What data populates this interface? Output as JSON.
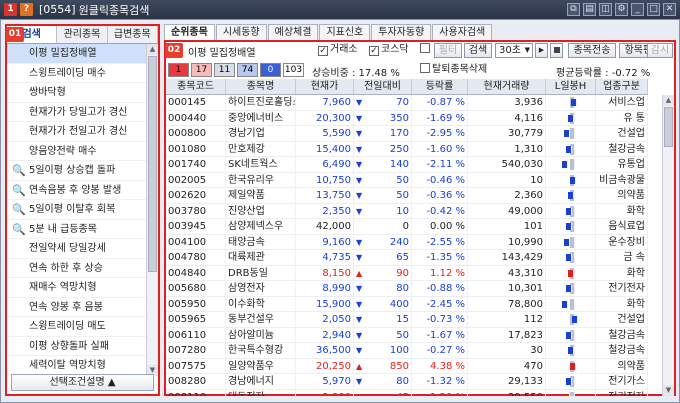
{
  "window": {
    "code": "[0554]",
    "title": "원클릭종목검색",
    "icon_one": "1",
    "icon_q": "?"
  },
  "badges": {
    "left": "01",
    "right": "02"
  },
  "left_tabs": [
    "검색",
    "관리종목",
    "급변종목"
  ],
  "left_items": [
    {
      "label": "이평 밀집정배열",
      "icon": false,
      "selected": true
    },
    {
      "label": "스윙트레이딩 매수",
      "icon": false
    },
    {
      "label": "쌍바닥형",
      "icon": false
    },
    {
      "label": "현재가가 당일고가 경신",
      "icon": false
    },
    {
      "label": "현재가가 전일고가 경신",
      "icon": false
    },
    {
      "label": "양음양전략 매수",
      "icon": false
    },
    {
      "label": "5일이평 상승캡 돌파",
      "icon": true
    },
    {
      "label": "연속음봉 후 양봉 발생",
      "icon": true
    },
    {
      "label": "5일이평 이탈후 회복",
      "icon": true
    },
    {
      "label": "5분 내 급등종목",
      "icon": true
    },
    {
      "label": "전일약세 당일강세",
      "icon": false
    },
    {
      "label": "연속 하한 후 상승",
      "icon": false
    },
    {
      "label": "재매수 역망치형",
      "icon": false
    },
    {
      "label": "연속 양봉 후 음봉",
      "icon": false
    },
    {
      "label": "스윙트레이딩 매도",
      "icon": false
    },
    {
      "label": "이평 상향돌파 실패",
      "icon": false
    },
    {
      "label": "세력이탈 역망치형",
      "icon": false
    },
    {
      "label": "5일선견접후 반등",
      "icon": true
    }
  ],
  "left_button": "선택조건설명 ▲",
  "right_tabs": [
    "순위종목",
    "시세동향",
    "예상체결",
    "지표신호",
    "투자자동향",
    "사용자검색"
  ],
  "search": {
    "name": "이평 밀집정배열",
    "kospi_check_label": "거래소",
    "kosdaq_check_label": "코스닥",
    "filter_label": "필터",
    "search_label": "검색",
    "interval_value": "30초",
    "send_label": "종목전송",
    "edit_label": "항목편집",
    "watch_label": "감시",
    "counts": [
      {
        "value": "1",
        "bg": "#e83a3a",
        "fg": "#000"
      },
      {
        "value": "17",
        "bg": "#f7b9b9",
        "fg": "#000"
      },
      {
        "value": "11",
        "bg": "#d9dde5",
        "fg": "#000"
      },
      {
        "value": "74",
        "bg": "#b7c7f0",
        "fg": "#000"
      },
      {
        "value": "0",
        "bg": "#3b5fdb",
        "fg": "#fff"
      },
      {
        "value": "103",
        "bg": "#ffffff",
        "fg": "#000"
      }
    ],
    "ratio_text": "상승비중 : 17.48 %",
    "exclude_label": "탈퇴종목삭제",
    "avg_text": "평균등락률 : -0.72 %"
  },
  "table": {
    "headers": [
      "종목코드",
      "종목명",
      "현재가",
      "전일대비",
      "등락률",
      "현재거래량",
      "L일봉H",
      "업종구분"
    ],
    "rows": [
      {
        "code": "000145",
        "name": "하이트진로홀딩스우",
        "price": "7,960",
        "dir": "dn",
        "chg": "70",
        "rate": "-0.87 %",
        "vol": "3,936",
        "ind": "서비스업",
        "lb": 0.62
      },
      {
        "code": "000440",
        "name": "중앙에너비스",
        "price": "20,300",
        "dir": "dn",
        "chg": "350",
        "rate": "-1.69 %",
        "vol": "4,116",
        "ind": "유 통",
        "lb": 0.55
      },
      {
        "code": "000800",
        "name": "경남기업",
        "price": "5,590",
        "dir": "dn",
        "chg": "170",
        "rate": "-2.95 %",
        "vol": "30,779",
        "ind": "건설업",
        "lb": 0.45
      },
      {
        "code": "001080",
        "name": "만호제강",
        "price": "15,400",
        "dir": "dn",
        "chg": "250",
        "rate": "-1.60 %",
        "vol": "1,310",
        "ind": "철강금속",
        "lb": 0.5
      },
      {
        "code": "001740",
        "name": "SK네트웍스",
        "price": "6,490",
        "dir": "dn",
        "chg": "140",
        "rate": "-2.11 %",
        "vol": "540,030",
        "ind": "유통업",
        "lb": 0.4
      },
      {
        "code": "002005",
        "name": "한국유리우",
        "price": "10,750",
        "dir": "dn",
        "chg": "50",
        "rate": "-0.46 %",
        "vol": "10",
        "ind": "비금속광물",
        "lb": 0.6
      },
      {
        "code": "002620",
        "name": "제일약품",
        "price": "13,750",
        "dir": "dn",
        "chg": "50",
        "rate": "-0.36 %",
        "vol": "2,360",
        "ind": "의약품",
        "lb": 0.55
      },
      {
        "code": "003780",
        "name": "진양산업",
        "price": "2,350",
        "dir": "dn",
        "chg": "10",
        "rate": "-0.42 %",
        "vol": "49,000",
        "ind": "화학",
        "lb": 0.5
      },
      {
        "code": "003945",
        "name": "삼양제넥스우",
        "price": "42,000",
        "dir": "",
        "chg": "0",
        "rate": "0.00 %",
        "vol": "101",
        "ind": "음식료업",
        "lb": 0.5
      },
      {
        "code": "004100",
        "name": "태양금속",
        "price": "9,160",
        "dir": "dn",
        "chg": "240",
        "rate": "-2.55 %",
        "vol": "10,990",
        "ind": "운수장비",
        "lb": 0.45
      },
      {
        "code": "004780",
        "name": "대륙제관",
        "price": "4,735",
        "dir": "dn",
        "chg": "65",
        "rate": "-1.35 %",
        "vol": "143,429",
        "ind": "금 속",
        "lb": 0.5
      },
      {
        "code": "004840",
        "name": "DRB동일",
        "price": "8,150",
        "dir": "up",
        "chg": "90",
        "rate": "1.12 %",
        "vol": "43,310",
        "ind": "화학",
        "lb": 0.55
      },
      {
        "code": "005680",
        "name": "삼영전자",
        "price": "8,990",
        "dir": "dn",
        "chg": "80",
        "rate": "-0.88 %",
        "vol": "10,301",
        "ind": "전기전자",
        "lb": 0.5
      },
      {
        "code": "005950",
        "name": "이수화학",
        "price": "15,900",
        "dir": "dn",
        "chg": "400",
        "rate": "-2.45 %",
        "vol": "78,800",
        "ind": "화학",
        "lb": 0.4
      },
      {
        "code": "005965",
        "name": "동부건설우",
        "price": "2,050",
        "dir": "dn",
        "chg": "15",
        "rate": "-0.73 %",
        "vol": "112",
        "ind": "건설업",
        "lb": 0.65
      },
      {
        "code": "006110",
        "name": "삼아알미늄",
        "price": "2,940",
        "dir": "dn",
        "chg": "50",
        "rate": "-1.67 %",
        "vol": "17,823",
        "ind": "철강금속",
        "lb": 0.5
      },
      {
        "code": "007280",
        "name": "한국특수형강",
        "price": "36,500",
        "dir": "dn",
        "chg": "100",
        "rate": "-0.27 %",
        "vol": "30",
        "ind": "철강금속",
        "lb": 0.55
      },
      {
        "code": "007575",
        "name": "일양약품우",
        "price": "20,250",
        "dir": "up",
        "chg": "850",
        "rate": "4.38 %",
        "vol": "470",
        "ind": "의약품",
        "lb": 0.6
      },
      {
        "code": "008280",
        "name": "경남에너지",
        "price": "5,970",
        "dir": "dn",
        "chg": "80",
        "rate": "-1.32 %",
        "vol": "29,133",
        "ind": "전기가스",
        "lb": 0.5
      },
      {
        "code": "008110",
        "name": "대동전자",
        "price": "3,880",
        "dir": "up",
        "chg": "45",
        "rate": "1.20 %",
        "vol": "29,550",
        "ind": "전기전자",
        "lb": 0.45
      }
    ]
  }
}
